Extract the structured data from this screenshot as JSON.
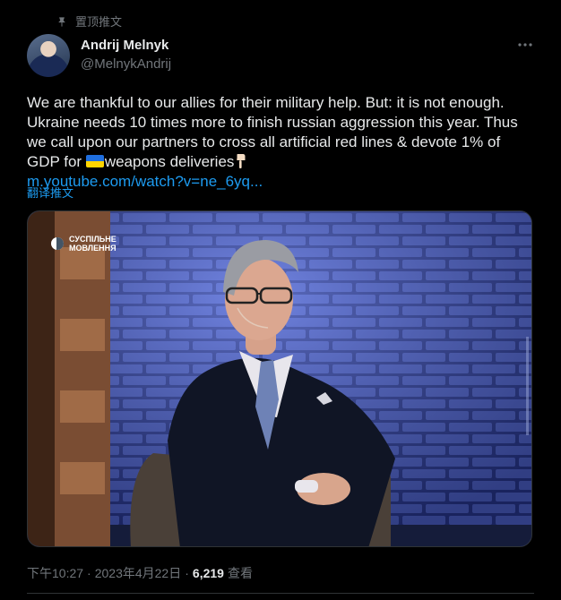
{
  "pinned": {
    "label": "置顶推文",
    "icon": "pin-icon"
  },
  "author": {
    "name": "Andrij Melnyk",
    "handle": "@MelnykAndrij",
    "avatar_icon": "avatar"
  },
  "more_icon": "more-horizontal-icon",
  "tweet": {
    "line1": "We are thankful to our allies for their military help. But: it is not enough.",
    "line2": "Ukraine needs 10 times more to finish russian aggression this year. Thus",
    "line3": "we call upon our partners to cross all artificial red lines & devote 1% of",
    "line4_before": "GDP for ",
    "line4_after": "weapons deliveries",
    "flag_icon": "ukraine-flag-icon",
    "hand_icon": "backhand-index-down-icon",
    "link": "m.youtube.com/watch?v=ne_6yq..."
  },
  "translate_label": "翻译推文",
  "media": {
    "watermark": [
      "СУСПІЛЬНЕ",
      "МОВЛЕННЯ"
    ]
  },
  "meta": {
    "time": "下午10:27",
    "separator": "·",
    "date": "2023年4月22日",
    "views_count": "6,219",
    "views_label": "查看"
  },
  "colors": {
    "background": "#000000",
    "text": "#e7e9ea",
    "secondary": "#71767b",
    "link": "#1d9bf0"
  }
}
